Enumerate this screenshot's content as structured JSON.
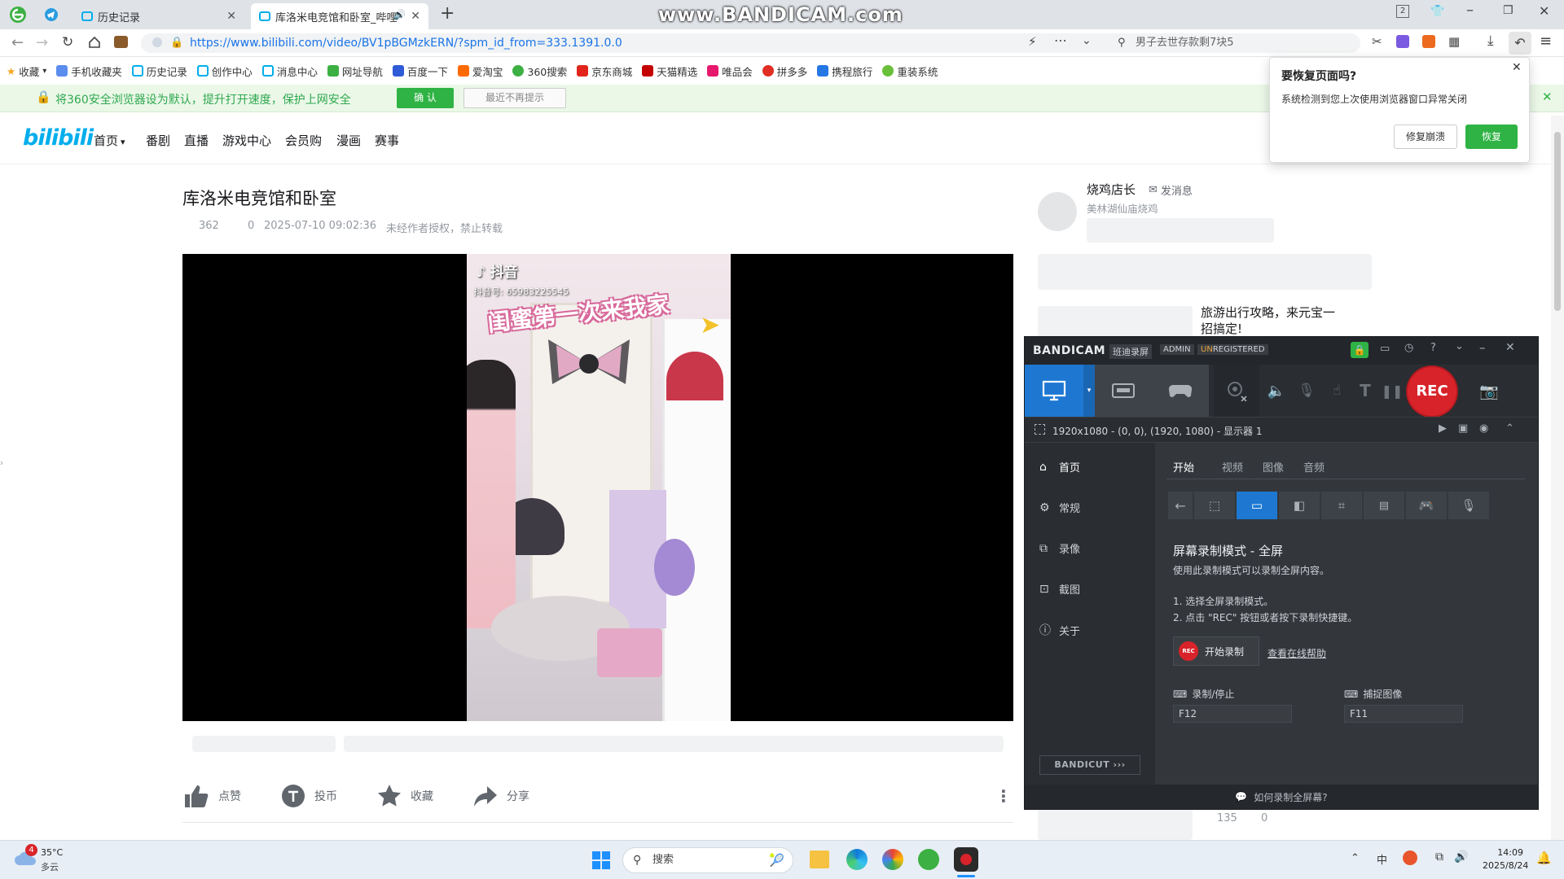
{
  "browser": {
    "tabs": [
      {
        "label": "历史记录"
      },
      {
        "label": "库洛米电竞馆和卧室_哔哩"
      }
    ],
    "url": "https://www.bilibili.com/video/BV1pBGMzkERN/?spm_id_from=333.1391.0.0",
    "url_host": "www.bilibili.com",
    "search_placeholder": "男子去世存款剩7块5",
    "bookmarks": [
      "收藏",
      "手机收藏夹",
      "历史记录",
      "创作中心",
      "消息中心",
      "网址导航",
      "百度一下",
      "爱淘宝",
      "360搜索",
      "京东商城",
      "天猫精选",
      "唯品会",
      "拼多多",
      "携程旅行",
      "重装系统"
    ],
    "notice": {
      "text": "将360安全浏览器设为默认，提升打开速度，保护上网安全",
      "confirm": "确 认",
      "dismiss": "最近不再提示"
    }
  },
  "restore_popup": {
    "title": "要恢复页面吗?",
    "message": "系统检测到您上次使用浏览器窗口异常关闭",
    "repair_button": "修复崩溃",
    "restore_button": "恢复"
  },
  "bilibili": {
    "logo": "bilibili",
    "nav": [
      "首页",
      "番剧",
      "直播",
      "游戏中心",
      "会员购",
      "漫画",
      "赛事"
    ],
    "video": {
      "title": "库洛米电竞馆和卧室",
      "views": "362",
      "danmaku": "0",
      "date": "2025-07-10 09:02:36",
      "copyright": "未经作者授权，禁止转载",
      "overlay_brand": "抖音",
      "overlay_id": "抖音号: 65983225545",
      "overlay_caption": "闺蜜第一次来我家"
    },
    "actions": [
      "点赞",
      "投币",
      "收藏",
      "分享"
    ],
    "uploader": {
      "name": "烧鸡店长",
      "message_label": "发消息",
      "bio": "美林湖仙庙烧鸡"
    },
    "recommend": {
      "title": "旅游出行攻略，来元宝一招搞定!",
      "stat1": "135",
      "stat2": "0"
    }
  },
  "bandicam": {
    "brand": "BANDICAM",
    "subtitle": "班迪录屏",
    "admin": "ADMIN",
    "registered_prefix": "UN",
    "registered": "REGISTERED",
    "rec_label": "REC",
    "status": "1920x1080 - (0, 0), (1920, 1080) - 显示器 1",
    "sidebar": [
      "首页",
      "常规",
      "录像",
      "截图",
      "关于"
    ],
    "bandicut": "BANDICUT",
    "tabs": [
      "开始",
      "视频",
      "图像",
      "音频"
    ],
    "mode_title": "屏幕录制模式 - 全屏",
    "mode_desc": "使用此录制模式可以录制全屏内容。",
    "step1": "1. 选择全屏录制模式。",
    "step2": "2. 点击 \"REC\" 按钮或者按下录制快捷键。",
    "start_rec": "开始录制",
    "rec_badge": "REC",
    "help_link": "查看在线帮助",
    "hotkey_rec_label": "录制/停止",
    "hotkey_rec": "F12",
    "hotkey_cap_label": "捕捉图像",
    "hotkey_cap": "F11",
    "footer": "如何录制全屏幕?"
  },
  "taskbar": {
    "weather_temp": "35°C",
    "weather_desc": "多云",
    "weather_badge": "4",
    "search": "搜索",
    "ime": "中",
    "time": "14:09",
    "date": "2025/8/24"
  },
  "colors": {
    "bili_blue": "#00aeec",
    "bandicam_blue": "#1e78d2",
    "rec_red": "#d8232a",
    "green": "#2fb344"
  }
}
